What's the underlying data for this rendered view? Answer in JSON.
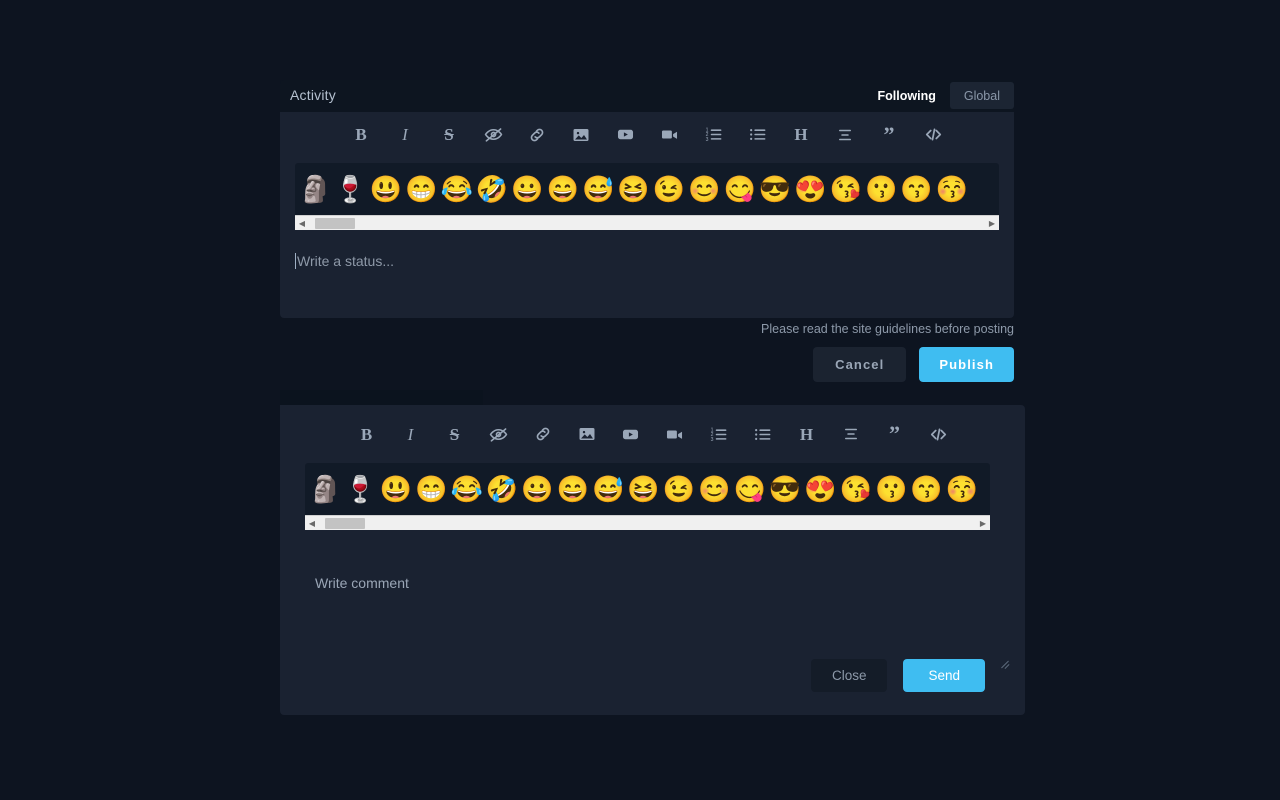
{
  "theme": {
    "page_bg": "#0d1420",
    "panel_bg": "#1a2231",
    "header_bg": "#0d1520",
    "accent": "#3fbdf1",
    "muted_text": "#8d99a9",
    "icon_color": "#9aa7b8",
    "scrollbar_track": "#f0f0f0",
    "scrollbar_thumb": "#c3c3c3"
  },
  "activity": {
    "title": "Activity",
    "tabs": [
      {
        "label": "Following",
        "active": true
      },
      {
        "label": "Global",
        "active": false
      }
    ],
    "status_placeholder": "Write a status...",
    "guidelines_note": "Please read the site guidelines before posting",
    "cancel_label": "Cancel",
    "publish_label": "Publish"
  },
  "comment": {
    "placeholder": "Write comment",
    "close_label": "Close",
    "send_label": "Send"
  },
  "toolbar": {
    "buttons": [
      {
        "name": "bold-icon",
        "glyph": "B",
        "title": "Bold"
      },
      {
        "name": "italic-icon",
        "glyph": "I",
        "title": "Italic"
      },
      {
        "name": "strikethrough-icon",
        "glyph": "S",
        "title": "Strikethrough"
      },
      {
        "name": "spoiler-eye-off-icon",
        "glyph": "",
        "title": "Spoiler"
      },
      {
        "name": "link-icon",
        "glyph": "",
        "title": "Link"
      },
      {
        "name": "image-icon",
        "glyph": "",
        "title": "Image"
      },
      {
        "name": "youtube-icon",
        "glyph": "",
        "title": "YouTube video"
      },
      {
        "name": "video-icon",
        "glyph": "",
        "title": "Video"
      },
      {
        "name": "ordered-list-icon",
        "glyph": "",
        "title": "Ordered list"
      },
      {
        "name": "bullet-list-icon",
        "glyph": "",
        "title": "Bullet list"
      },
      {
        "name": "heading-icon",
        "glyph": "H",
        "title": "Heading"
      },
      {
        "name": "align-center-icon",
        "glyph": "",
        "title": "Center align"
      },
      {
        "name": "quote-icon",
        "glyph": "”",
        "title": "Quote"
      },
      {
        "name": "code-icon",
        "glyph": "",
        "title": "Code"
      }
    ]
  },
  "emoji_picker": {
    "scroll_left_arrow": "◀",
    "scroll_right_arrow": "▶",
    "emojis": [
      {
        "char": "🗿",
        "name": "moai"
      },
      {
        "char": "🍷",
        "name": "wine-glass"
      },
      {
        "char": "😃",
        "name": "grinning-face-big-eyes"
      },
      {
        "char": "😁",
        "name": "beaming-face"
      },
      {
        "char": "😂",
        "name": "face-with-tears-of-joy"
      },
      {
        "char": "🤣",
        "name": "rolling-on-the-floor-laughing"
      },
      {
        "char": "😀",
        "name": "grinning-face"
      },
      {
        "char": "😄",
        "name": "grinning-face-smiling-eyes"
      },
      {
        "char": "😅",
        "name": "grinning-face-with-sweat"
      },
      {
        "char": "😆",
        "name": "squinting-face-with-tongue"
      },
      {
        "char": "😉",
        "name": "winking-face"
      },
      {
        "char": "😊",
        "name": "smiling-face-smiling-eyes"
      },
      {
        "char": "😋",
        "name": "face-savoring-food"
      },
      {
        "char": "😎",
        "name": "smiling-face-with-sunglasses"
      },
      {
        "char": "😍",
        "name": "smiling-face-with-heart-eyes"
      },
      {
        "char": "😘",
        "name": "face-blowing-a-kiss"
      },
      {
        "char": "😗",
        "name": "kissing-face"
      },
      {
        "char": "😙",
        "name": "kissing-face-smiling-eyes"
      },
      {
        "char": "😚",
        "name": "kissing-face-closed-eyes"
      }
    ]
  }
}
